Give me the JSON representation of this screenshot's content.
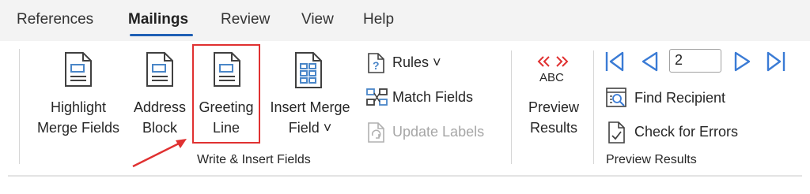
{
  "tabs": [
    {
      "label": "References"
    },
    {
      "label": "Mailings"
    },
    {
      "label": "Review"
    },
    {
      "label": "View"
    },
    {
      "label": "Help"
    }
  ],
  "write_insert": {
    "highlight_line1": "Highlight",
    "highlight_line2": "Merge Fields",
    "address_line1": "Address",
    "address_line2": "Block",
    "greeting_line1": "Greeting",
    "greeting_line2": "Line",
    "insert_merge_line1": "Insert Merge",
    "insert_merge_line2": "Field ˅",
    "rules": "Rules ˅",
    "match_fields": "Match Fields",
    "update_labels": "Update Labels",
    "group_label": "Write & Insert Fields"
  },
  "preview": {
    "abc": "ABC",
    "preview_line1": "Preview",
    "preview_line2": "Results",
    "record_number": "2",
    "find_recipient": "Find Recipient",
    "check_errors": "Check for Errors",
    "group_label": "Preview Results"
  },
  "colors": {
    "accent_blue": "#1f5fb4",
    "highlight_red": "#e03131",
    "icon_blue": "#4a86c8"
  }
}
